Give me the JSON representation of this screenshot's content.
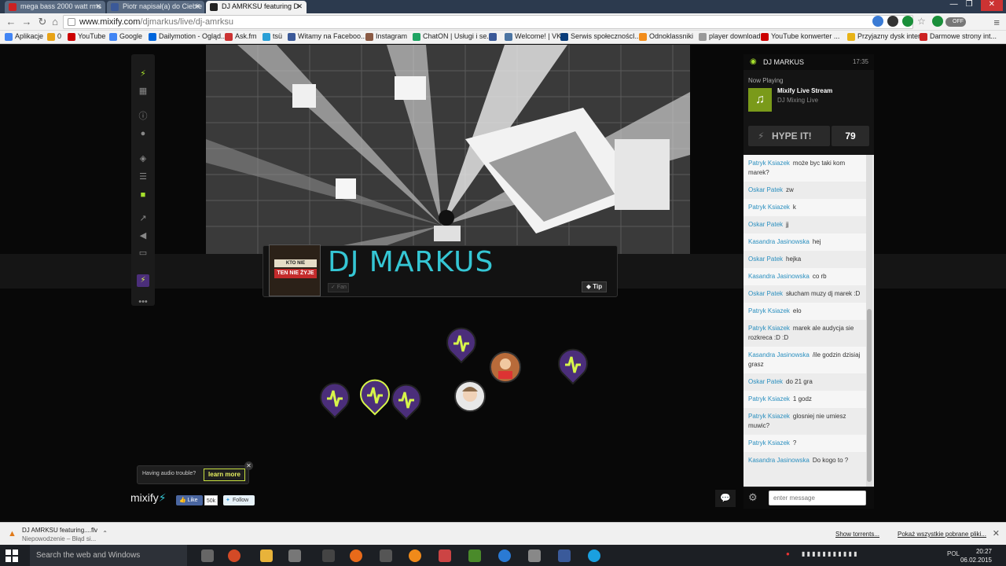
{
  "browser": {
    "tabs": [
      {
        "label": "mega bass 2000 watt rms",
        "favicon_color": "#cc2222"
      },
      {
        "label": "Piotr napisał(a) do Ciebie",
        "favicon_color": "#3b5998"
      },
      {
        "label": "DJ AMRKSU featuring D",
        "favicon_color": "#222222"
      }
    ],
    "url_domain": "www.mixify.com",
    "url_path": "/djmarkus/live/dj-amrksu",
    "toggle_label": "OFF",
    "bookmarks": [
      {
        "label": "Aplikacje",
        "color": "#4285f4"
      },
      {
        "label": "0",
        "color": "#e8a317"
      },
      {
        "label": "YouTube",
        "color": "#cc0000"
      },
      {
        "label": "Google",
        "color": "#4285f4"
      },
      {
        "label": "Dailymotion - Ogląd...",
        "color": "#0066dc"
      },
      {
        "label": "Ask.fm",
        "color": "#cc3333"
      },
      {
        "label": "tsü",
        "color": "#2a9fd6"
      },
      {
        "label": "Witamy na Faceboo...",
        "color": "#3b5998"
      },
      {
        "label": "Instagram",
        "color": "#8a5a44"
      },
      {
        "label": "ChatON | Usługi i se...",
        "color": "#1fa463"
      },
      {
        "label": "",
        "color": "#3b5998"
      },
      {
        "label": "Welcome! | VK",
        "color": "#4c75a3"
      },
      {
        "label": "Serwis społecznoścI...",
        "color": "#0a3d7a"
      },
      {
        "label": "Odnoklassniki",
        "color": "#f28c1a"
      },
      {
        "label": "player download",
        "color": "#999999"
      },
      {
        "label": "YouTube konwerter ...",
        "color": "#cc0000"
      },
      {
        "label": "Przyjazny dysk inter...",
        "color": "#e8b317"
      },
      {
        "label": "Darmowe strony int...",
        "color": "#cc2222"
      }
    ]
  },
  "dj": {
    "name": "DJ MARKUS",
    "avatar_line1": "KTO NIE POMPUJE",
    "avatar_line2": "TEN NIE ŻYJE",
    "fan_label": "Fan",
    "tip_label": "Tip"
  },
  "audio_tip": {
    "text": "Having audio trouble?",
    "button": "learn more"
  },
  "social": {
    "logo_text": "mixify",
    "like_label": "Like",
    "like_count": "50k",
    "follow_label": "Follow"
  },
  "panel": {
    "station": "DJ MARKUS",
    "time": "17:35",
    "now_playing_label": "Now Playing",
    "track_title": "Mixify Live Stream",
    "track_sub": "DJ Mixing Live",
    "hype_label": "HYPE IT!",
    "hype_count": "79",
    "input_placeholder": "enter message"
  },
  "chat": [
    {
      "user": "Patryk Ksiazek",
      "text": "może byc taki kom marek?"
    },
    {
      "user": "Oskar Patek",
      "text": "zw"
    },
    {
      "user": "Patryk Ksiazek",
      "text": "k"
    },
    {
      "user": "Oskar Patek",
      "text": "jj"
    },
    {
      "user": "Kasandra Jasinowska",
      "text": "hej"
    },
    {
      "user": "Oskar Patek",
      "text": "hejka"
    },
    {
      "user": "Kasandra Jasinowska",
      "text": "co rb"
    },
    {
      "user": "Oskar Patek",
      "text": "słucham muzy dj marek :D"
    },
    {
      "user": "Patryk Ksiazek",
      "text": "elo"
    },
    {
      "user": "Patryk Ksiazek",
      "text": "marek ale audycja sie rozkreca :D :D"
    },
    {
      "user": "Kasandra Jasinowska",
      "text": "/ile godzin dzisiaj grasz"
    },
    {
      "user": "Oskar Patek",
      "text": "do 21 gra"
    },
    {
      "user": "Patryk Ksiazek",
      "text": "1 godz"
    },
    {
      "user": "Patryk Ksiazek",
      "text": "glosniej nie umiesz muwic?"
    },
    {
      "user": "Patryk Ksiazek",
      "text": "?"
    },
    {
      "user": "Kasandra Jasinowska",
      "text": "Do kogo to ?"
    }
  ],
  "downloads": {
    "file": "DJ AMRKSU featuring....flv",
    "status": "Niepowodzenie – Błąd si...",
    "show_torrents": "Show torrents...",
    "show_all": "Pokaż wszystkie pobrane pliki..."
  },
  "taskbar": {
    "search_placeholder": "Search the web and Windows",
    "lang": "POL",
    "time": "20:27",
    "date": "06.02.2015"
  },
  "colors": {
    "accent_cyan": "#35c6d4",
    "accent_green": "#a6e02c",
    "marker_purple": "#4b2e7a"
  }
}
